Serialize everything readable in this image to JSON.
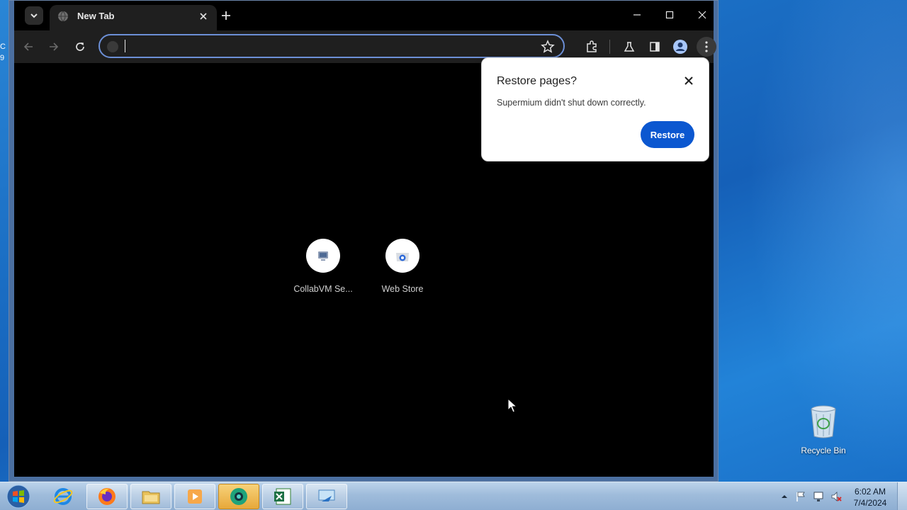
{
  "browser": {
    "tab": {
      "title": "New Tab"
    },
    "omnibox": {
      "value": "",
      "placeholder": ""
    },
    "shortcuts": [
      {
        "label": "CollabVM Se..."
      },
      {
        "label": "Web Store"
      }
    ],
    "popup": {
      "title": "Restore pages?",
      "message": "Supermium didn't shut down correctly.",
      "restore_label": "Restore"
    }
  },
  "desktop": {
    "partial_icon_text": "C\n9",
    "recycle_bin_label": "Recycle Bin"
  },
  "taskbar": {
    "pinned_apps": [
      "internet-explorer",
      "firefox",
      "file-explorer",
      "media-player",
      "supermium",
      "excel",
      "remote-desktop"
    ],
    "clock": {
      "time": "6:02 AM",
      "date": "7/4/2024"
    }
  },
  "colors": {
    "accent": "#0b57d0",
    "omnibox_focus": "#6c8fd6",
    "browser_dark": "#1f1f1f"
  }
}
